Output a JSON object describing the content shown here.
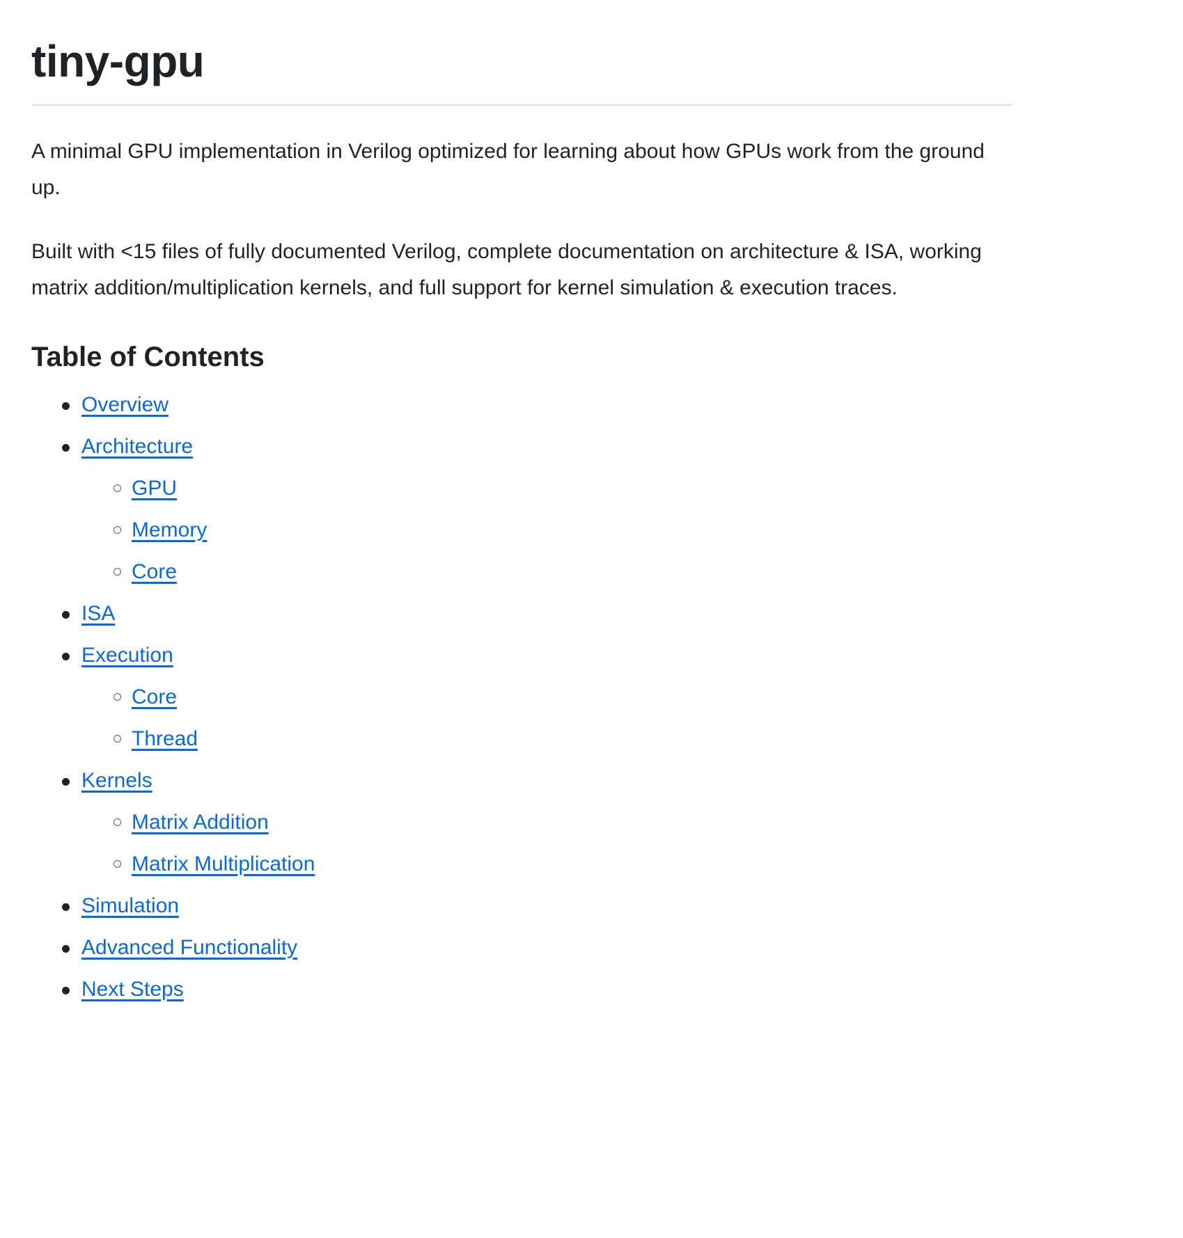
{
  "document": {
    "title": "tiny-gpu",
    "paragraphs": [
      "A minimal GPU implementation in Verilog optimized for learning about how GPUs work from the ground up.",
      "Built with <15 files of fully documented Verilog, complete documentation on architecture & ISA, working matrix addition/multiplication kernels, and full support for kernel simulation & execution traces."
    ],
    "toc": {
      "heading": "Table of Contents",
      "items": [
        {
          "label": "Overview",
          "children": []
        },
        {
          "label": "Architecture",
          "children": [
            {
              "label": "GPU"
            },
            {
              "label": "Memory"
            },
            {
              "label": "Core"
            }
          ]
        },
        {
          "label": "ISA",
          "children": []
        },
        {
          "label": "Execution",
          "children": [
            {
              "label": "Core"
            },
            {
              "label": "Thread"
            }
          ]
        },
        {
          "label": "Kernels",
          "children": [
            {
              "label": "Matrix Addition"
            },
            {
              "label": "Matrix Multiplication"
            }
          ]
        },
        {
          "label": "Simulation",
          "children": []
        },
        {
          "label": "Advanced Functionality",
          "children": []
        },
        {
          "label": "Next Steps",
          "children": []
        }
      ]
    }
  },
  "colors": {
    "text": "#1f2328",
    "link": "#0969da",
    "rule": "#d8dee4",
    "background": "#ffffff",
    "sub_bullet_border": "#57606a"
  }
}
